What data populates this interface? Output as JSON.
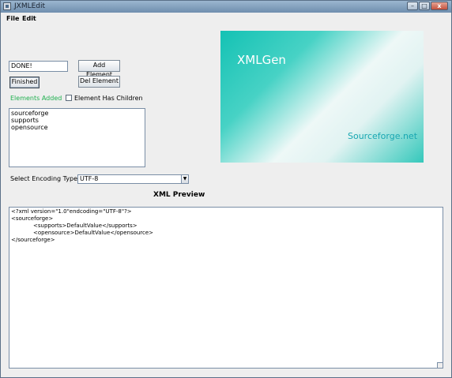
{
  "window": {
    "title": "JXMLEdit",
    "minimize_glyph": "–",
    "maximize_glyph": "□",
    "close_glyph": "x"
  },
  "menubar": {
    "items": [
      {
        "label": "File"
      },
      {
        "label": "Edit"
      }
    ]
  },
  "form": {
    "element_input_value": "DONE!",
    "add_element_label": "Add Element",
    "del_element_label": "Del Element",
    "finished_label": "Finished",
    "status_text": "Elements Added",
    "status_color": "#1fb04f",
    "has_children_label": "Element Has Children",
    "has_children_checked": false
  },
  "element_list": {
    "items": [
      "sourceforge",
      "supports",
      "opensource"
    ]
  },
  "encoding": {
    "label": "Select Encoding Type",
    "selected": "UTF-8",
    "arrow_icon": "chevron-down-icon"
  },
  "preview": {
    "title": "XML Preview",
    "lines": [
      "<?xml version=\"1.0\"endcoding=\"UTF-8\"?>",
      "<sourceforge>",
      "<supports>DefaultValue</supports>",
      "<opensource>DefaultValue</opensource>",
      "</sourceforge>"
    ]
  },
  "banner": {
    "title": "XMLGen",
    "subtitle": "Sourceforge.net",
    "accent": "#14c2b4"
  }
}
